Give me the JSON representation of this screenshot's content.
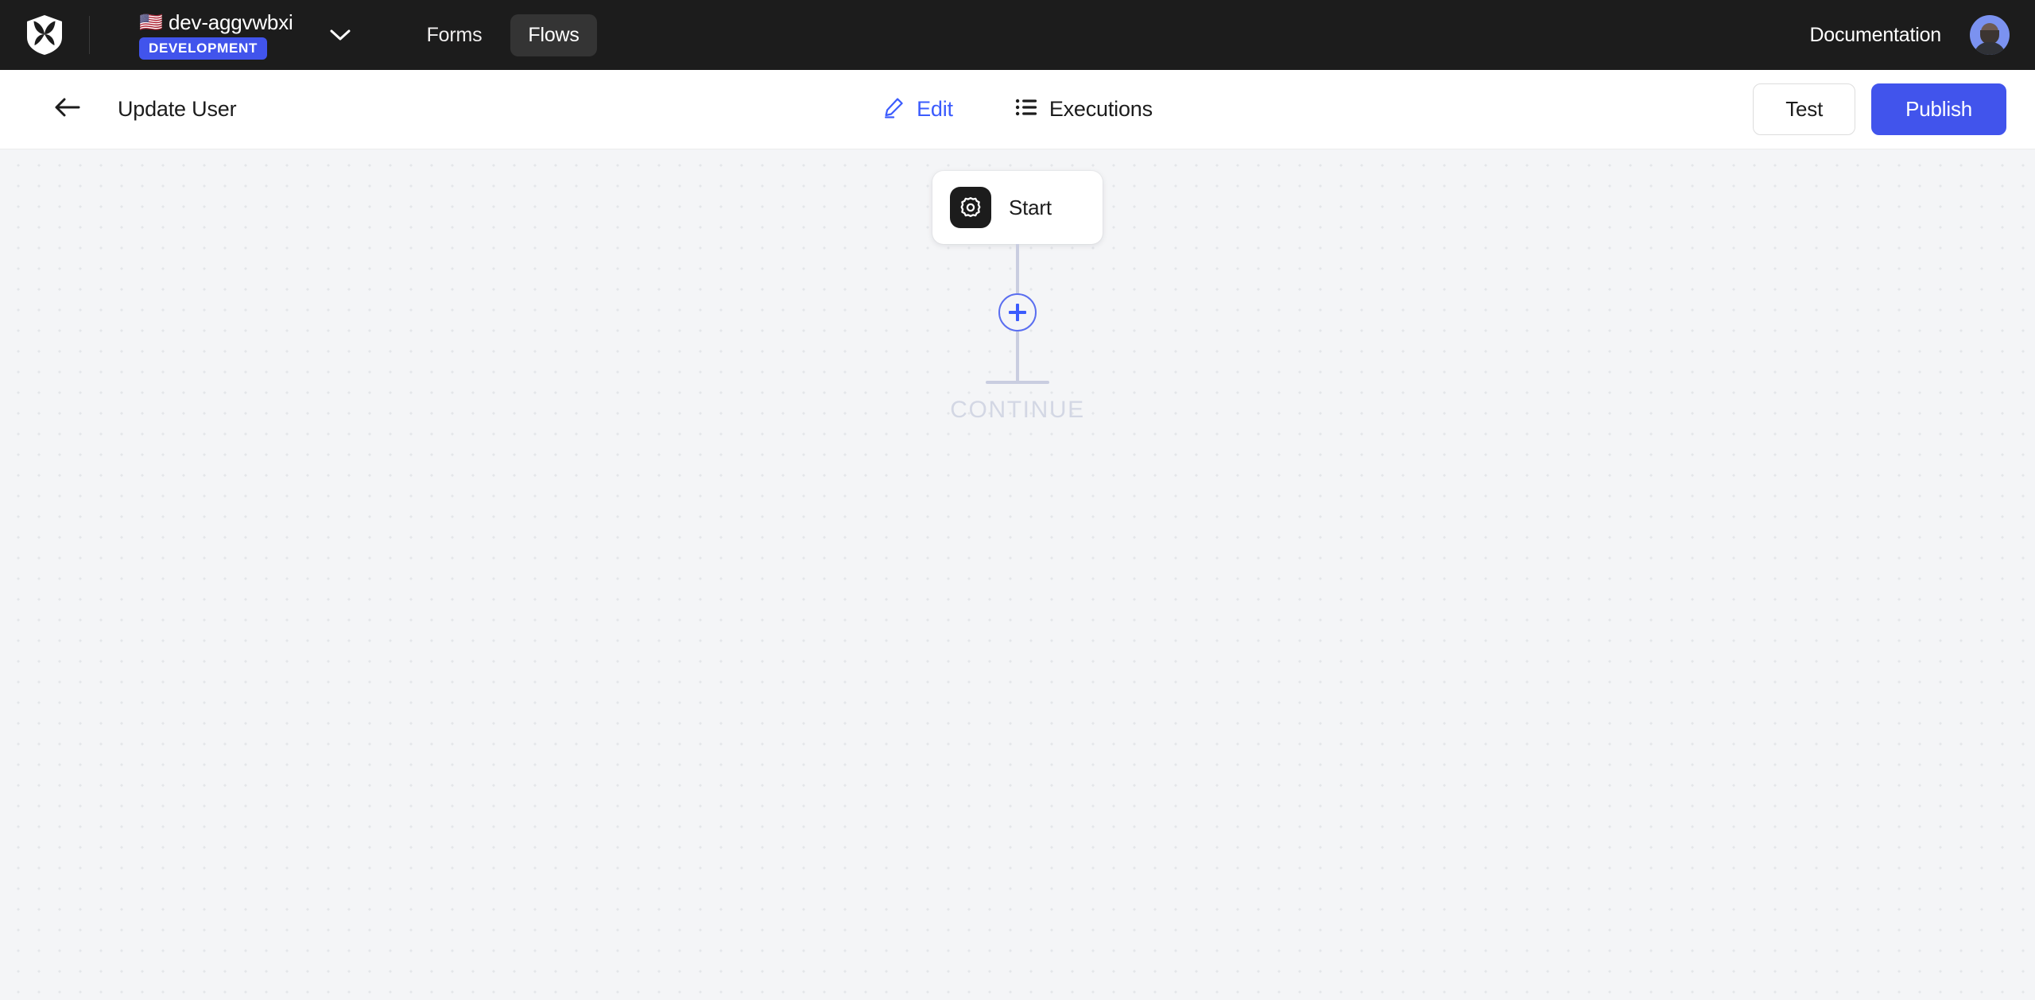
{
  "topnav": {
    "logo_icon": "shield-logo-icon",
    "environment": {
      "flag": "🇺🇸",
      "name": "dev-aggvwbxi",
      "badge": "DEVELOPMENT",
      "badge_color": "#4154ec",
      "chevron_icon": "chevron-down-icon"
    },
    "tabs": [
      {
        "label": "Forms",
        "active": false
      },
      {
        "label": "Flows",
        "active": true
      }
    ],
    "documentation_label": "Documentation",
    "avatar_icon": "user-avatar",
    "background_color": "#1c1c1c"
  },
  "subheader": {
    "back_icon": "arrow-left-icon",
    "title": "Update User",
    "center_tabs": [
      {
        "label": "Edit",
        "icon": "pencil-icon",
        "active": true
      },
      {
        "label": "Executions",
        "icon": "list-icon",
        "active": false
      }
    ],
    "active_color": "#3b5bfd",
    "test_label": "Test",
    "publish_label": "Publish",
    "publish_color": "#4154ec"
  },
  "canvas": {
    "background_color": "#f4f5f7",
    "dot_color": "#e4e6ea",
    "nodes": [
      {
        "label": "Start",
        "icon": "gear-icon"
      }
    ],
    "add_step_icon": "plus-icon",
    "continue_label": "CONTINUE",
    "continue_color": "#d3d7e4"
  }
}
